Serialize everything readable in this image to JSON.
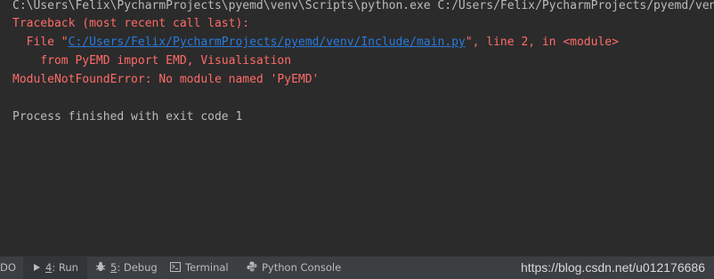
{
  "console": {
    "command_line": "C:\\Users\\Felix\\PycharmProjects\\pyemd\\venv\\Scripts\\python.exe C:/Users/Felix/PycharmProjects/pyemd/venv/",
    "traceback_header": "Traceback (most recent call last):",
    "file_prefix": "  File \"",
    "file_link": "C:/Users/Felix/PycharmProjects/pyemd/venv/Include/main.py",
    "file_suffix": "\", line 2, in <module>",
    "source_line": "    from PyEMD import EMD, Visualisation",
    "error_line": "ModuleNotFoundError: No module named 'PyEMD'",
    "exit_line": "Process finished with exit code 1"
  },
  "toolbar": {
    "todo_fragment": "DO",
    "tabs": [
      {
        "mnemonic": "4",
        "rest": ": Run",
        "icon": "run-icon"
      },
      {
        "mnemonic": "5",
        "rest": ": Debug",
        "icon": "debug-icon"
      },
      {
        "mnemonic": "",
        "rest": "Terminal",
        "icon": "terminal-icon"
      },
      {
        "mnemonic": "",
        "rest": "Python Console",
        "icon": "python-console-icon"
      }
    ]
  },
  "watermark": "https://blog.csdn.net/u012176686",
  "colors": {
    "background": "#2b2b2b",
    "error_text": "#ff6b68",
    "link": "#287bde",
    "normal_text": "#bbbbbb",
    "toolbar": "#3c3f41"
  }
}
